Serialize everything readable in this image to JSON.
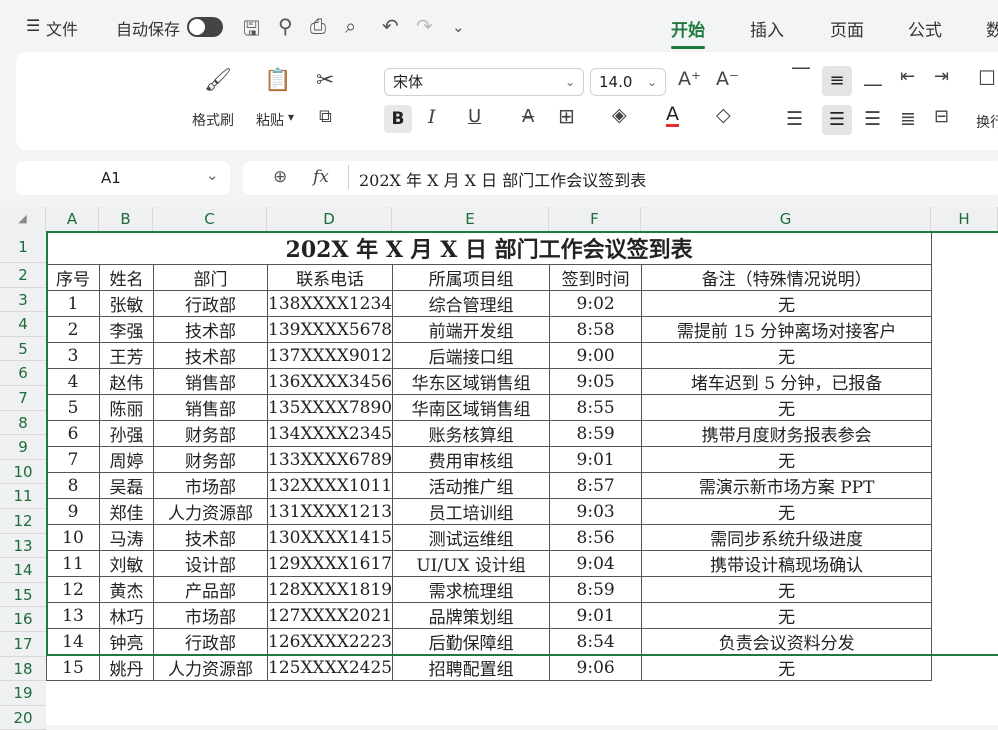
{
  "menu": {
    "hamburger": "☰",
    "file": "文件",
    "autosave": "自动保存",
    "tabs": [
      "开始",
      "插入",
      "页面",
      "公式",
      "数"
    ]
  },
  "ribbon": {
    "format_painter": "格式刷",
    "paste": "粘贴",
    "paste_arrow": "▾",
    "font_name": "宋体",
    "font_size": "14.0",
    "wrap": "换行"
  },
  "formula_bar": {
    "cell_ref": "A1",
    "fx": "fx",
    "content": "202X 年 X 月 X 日 部门工作会议签到表"
  },
  "columns": [
    "A",
    "B",
    "C",
    "D",
    "E",
    "F",
    "G",
    "H"
  ],
  "rows": [
    "1",
    "2",
    "3",
    "4",
    "5",
    "6",
    "7",
    "8",
    "9",
    "10",
    "11",
    "12",
    "13",
    "14",
    "15",
    "16",
    "17",
    "18",
    "19",
    "20"
  ],
  "table": {
    "title": "202X 年 X 月 X 日 部门工作会议签到表",
    "headers": [
      "序号",
      "姓名",
      "部门",
      "联系电话",
      "所属项目组",
      "签到时间",
      "备注（特殊情况说明）"
    ],
    "rows": [
      [
        "1",
        "张敏",
        "行政部",
        "138XXXX1234",
        "综合管理组",
        "9:02",
        "无"
      ],
      [
        "2",
        "李强",
        "技术部",
        "139XXXX5678",
        "前端开发组",
        "8:58",
        "需提前 15 分钟离场对接客户"
      ],
      [
        "3",
        "王芳",
        "技术部",
        "137XXXX9012",
        "后端接口组",
        "9:00",
        "无"
      ],
      [
        "4",
        "赵伟",
        "销售部",
        "136XXXX3456",
        "华东区域销售组",
        "9:05",
        "堵车迟到 5 分钟，已报备"
      ],
      [
        "5",
        "陈丽",
        "销售部",
        "135XXXX7890",
        "华南区域销售组",
        "8:55",
        "无"
      ],
      [
        "6",
        "孙强",
        "财务部",
        "134XXXX2345",
        "账务核算组",
        "8:59",
        "携带月度财务报表参会"
      ],
      [
        "7",
        "周婷",
        "财务部",
        "133XXXX6789",
        "费用审核组",
        "9:01",
        "无"
      ],
      [
        "8",
        "吴磊",
        "市场部",
        "132XXXX1011",
        "活动推广组",
        "8:57",
        "需演示新市场方案 PPT"
      ],
      [
        "9",
        "郑佳",
        "人力资源部",
        "131XXXX1213",
        "员工培训组",
        "9:03",
        "无"
      ],
      [
        "10",
        "马涛",
        "技术部",
        "130XXXX1415",
        "测试运维组",
        "8:56",
        "需同步系统升级进度"
      ],
      [
        "11",
        "刘敏",
        "设计部",
        "129XXXX1617",
        "UI/UX 设计组",
        "9:04",
        "携带设计稿现场确认"
      ],
      [
        "12",
        "黄杰",
        "产品部",
        "128XXXX1819",
        "需求梳理组",
        "8:59",
        "无"
      ],
      [
        "13",
        "林巧",
        "市场部",
        "127XXXX2021",
        "品牌策划组",
        "9:01",
        "无"
      ],
      [
        "14",
        "钟亮",
        "行政部",
        "126XXXX2223",
        "后勤保障组",
        "8:54",
        "负责会议资料分发"
      ],
      [
        "15",
        "姚丹",
        "人力资源部",
        "125XXXX2425",
        "招聘配置组",
        "9:06",
        "无"
      ]
    ]
  },
  "colors": {
    "accent": "#1f7a3f",
    "selection": "#1f7a3f",
    "font_red": "#e03030"
  }
}
